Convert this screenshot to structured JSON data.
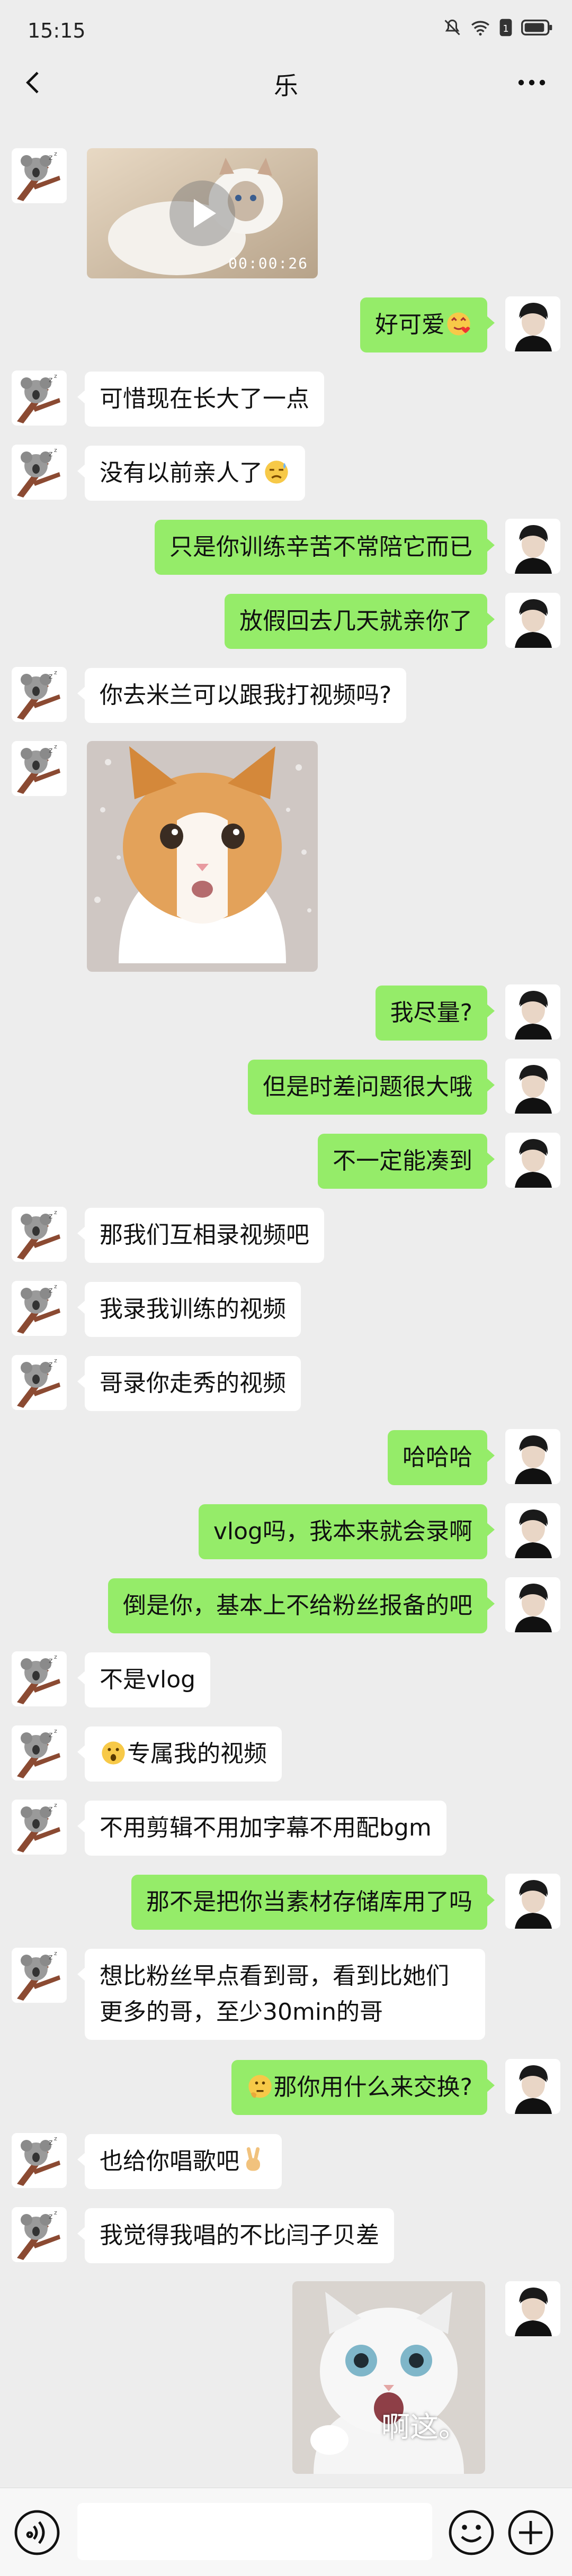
{
  "status_bar": {
    "time": "15:15"
  },
  "header": {
    "title": "乐"
  },
  "video": {
    "duration": "00:00:26"
  },
  "sticker": {
    "caption": "啊这。"
  },
  "messages": [
    {
      "side": "right",
      "text": "好可爱",
      "emoji": "heart-face"
    },
    {
      "side": "left",
      "text": "可惜现在长大了一点"
    },
    {
      "side": "left",
      "text": "没有以前亲人了",
      "emoji": "sweat-face"
    },
    {
      "side": "right",
      "text": "只是你训练辛苦不常陪它而已"
    },
    {
      "side": "right",
      "text": "放假回去几天就亲你了"
    },
    {
      "side": "left",
      "text": "你去米兰可以跟我打视频吗?"
    },
    {
      "side": "right",
      "text": "我尽量?"
    },
    {
      "side": "right",
      "text": "但是时差问题很大哦"
    },
    {
      "side": "right",
      "text": "不一定能凑到"
    },
    {
      "side": "left",
      "text": "那我们互相录视频吧"
    },
    {
      "side": "left",
      "text": "我录我训练的视频"
    },
    {
      "side": "left",
      "text": "哥录你走秀的视频"
    },
    {
      "side": "right",
      "text": "哈哈哈"
    },
    {
      "side": "right",
      "text": "vlog吗，我本来就会录啊"
    },
    {
      "side": "right",
      "text": "倒是你，基本上不给粉丝报备的吧"
    },
    {
      "side": "left",
      "text": "不是vlog"
    },
    {
      "side": "left",
      "text": "专属我的视频",
      "emoji_before": "surprised-face"
    },
    {
      "side": "left",
      "text": "不用剪辑不用加字幕不用配bgm"
    },
    {
      "side": "right",
      "text": "那不是把你当素材存储库用了吗"
    },
    {
      "side": "left",
      "text": "想比粉丝早点看到哥，看到比她们更多的哥，至少30min的哥"
    },
    {
      "side": "right",
      "text": "那你用什么来交换?",
      "emoji_before": "thinking-face"
    },
    {
      "side": "left",
      "text": "也给你唱歌吧",
      "emoji": "victory-hand"
    },
    {
      "side": "left",
      "text": "我觉得我唱的不比闫子贝差"
    }
  ]
}
